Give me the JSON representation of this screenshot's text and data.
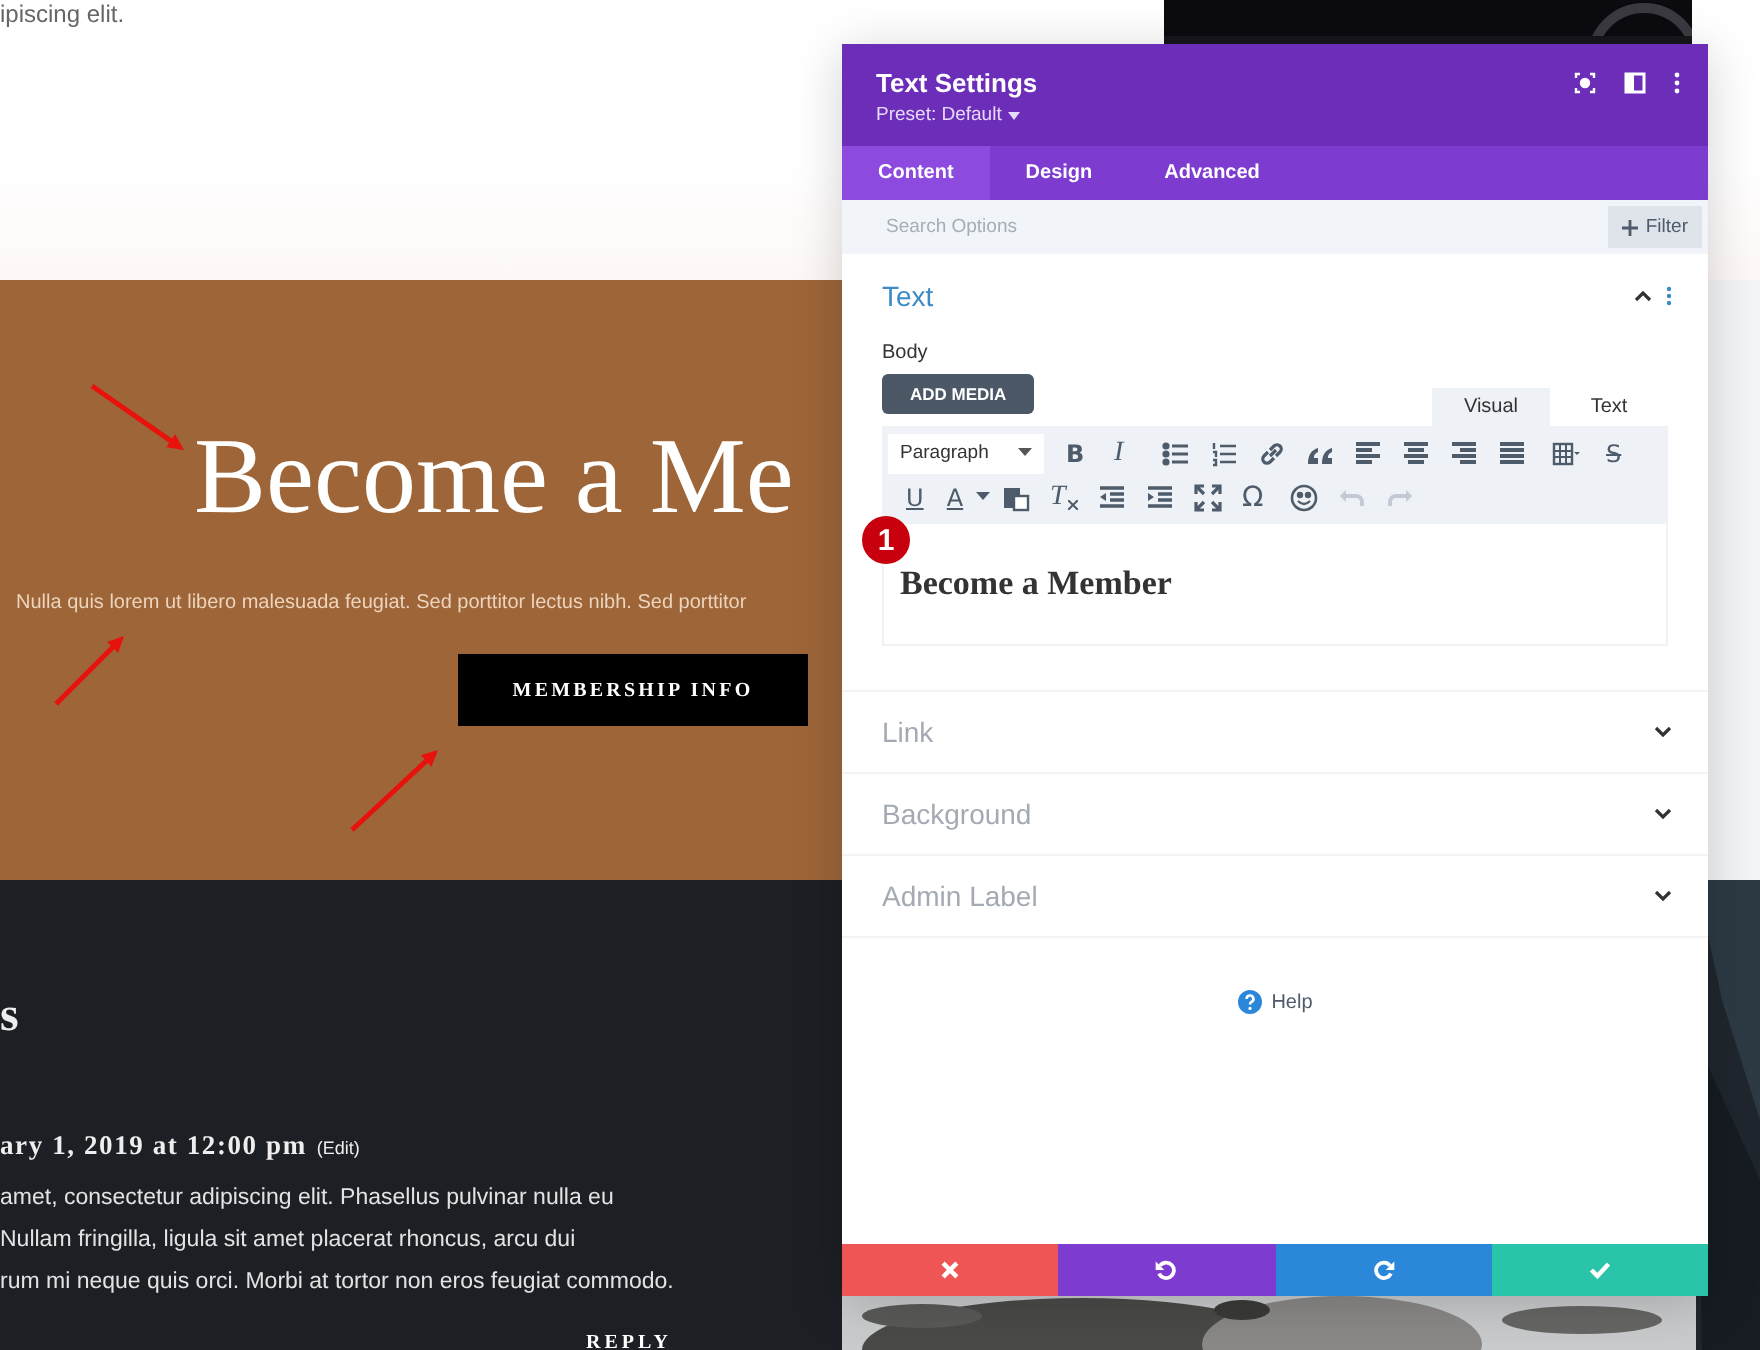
{
  "page": {
    "top_text": "ipiscing elit.",
    "hero": {
      "heading": "Become a Me",
      "paragraph": "Nulla quis lorem ut libero malesuada feugiat. Sed porttitor lectus nibh. Sed porttitor",
      "button": "MEMBERSHIP INFO"
    },
    "comments": {
      "heading": "s",
      "date": "ary 1, 2019 at 12:00 pm",
      "edit": "(Edit)",
      "lines": [
        "amet, consectetur adipiscing elit. Phasellus pulvinar nulla eu",
        "Nullam fringilla, ligula sit amet placerat rhoncus, arcu dui",
        "rum mi neque quis orci. Morbi at tortor non eros feugiat commodo."
      ],
      "reply": "REPLY"
    }
  },
  "badge": "1",
  "panel": {
    "title": "Text Settings",
    "preset": "Preset: Default",
    "tabs": [
      {
        "label": "Content",
        "selected": true
      },
      {
        "label": "Design",
        "selected": false
      },
      {
        "label": "Advanced",
        "selected": false
      }
    ],
    "search": {
      "placeholder": "Search Options"
    },
    "filter": "Filter",
    "sections": [
      {
        "title": "Text",
        "expanded": true
      },
      {
        "title": "Link",
        "expanded": false
      },
      {
        "title": "Background",
        "expanded": false
      },
      {
        "title": "Admin Label",
        "expanded": false
      }
    ],
    "editor": {
      "label": "Body",
      "add_media": "ADD MEDIA",
      "modes": [
        {
          "label": "Visual",
          "selected": true
        },
        {
          "label": "Text",
          "selected": false
        }
      ],
      "format": "Paragraph",
      "glyphs": [
        "B",
        "I",
        "S",
        "U",
        "A",
        "T",
        "Ω"
      ],
      "content": "Become a Member"
    },
    "help": "Help",
    "footer": [
      {
        "kind": "cancel"
      },
      {
        "kind": "undo"
      },
      {
        "kind": "redo"
      },
      {
        "kind": "save"
      }
    ]
  }
}
